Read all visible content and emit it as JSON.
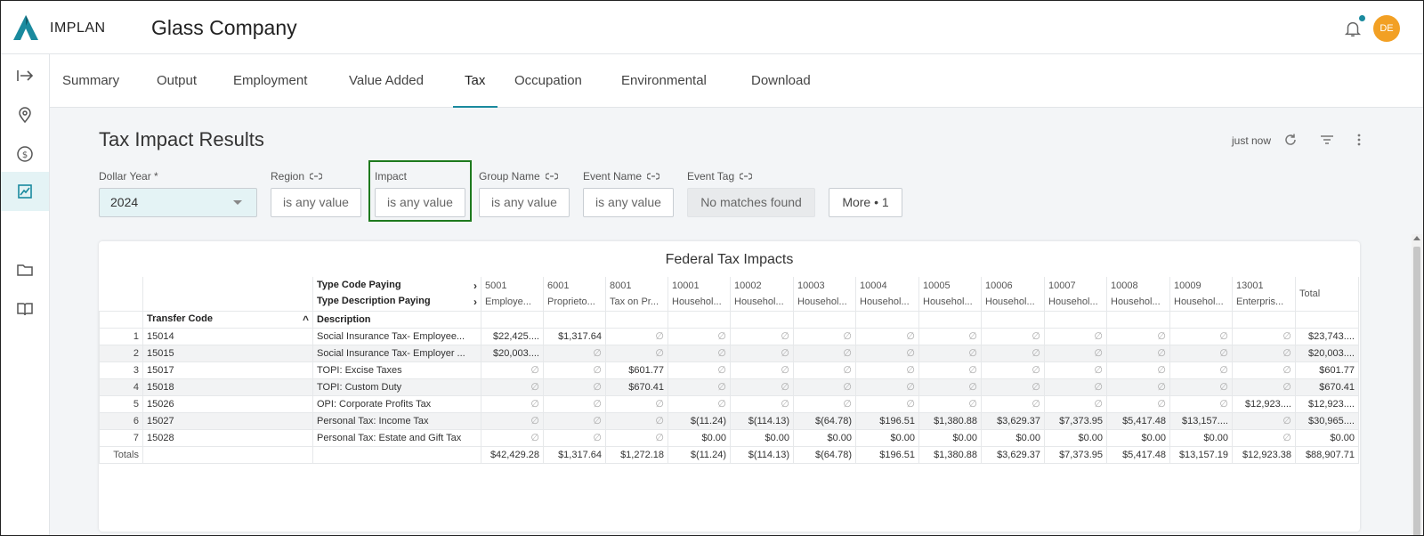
{
  "app": {
    "logo_text": "IMPLAN",
    "title": "Glass Company",
    "avatar_initials": "DE"
  },
  "tabs": [
    {
      "label": "Summary"
    },
    {
      "label": "Output"
    },
    {
      "label": "Employment"
    },
    {
      "label": "Value Added"
    },
    {
      "label": "Tax"
    },
    {
      "label": "Occupation"
    },
    {
      "label": "Environmental"
    },
    {
      "label": "Download"
    }
  ],
  "active_tab": "Tax",
  "page": {
    "title": "Tax Impact Results",
    "updated": "just now"
  },
  "filters": {
    "dollar_year": {
      "label": "Dollar Year *",
      "value": "2024"
    },
    "region": {
      "label": "Region",
      "value": "is any value"
    },
    "impact": {
      "label": "Impact",
      "value": "is any value"
    },
    "group_name": {
      "label": "Group Name",
      "value": "is any value"
    },
    "event_name": {
      "label": "Event Name",
      "value": "is any value"
    },
    "event_tag": {
      "label": "Event Tag",
      "value": "No matches found"
    },
    "more": {
      "label": "More • 1"
    }
  },
  "table": {
    "title": "Federal Tax Impacts",
    "header_type_code": "Type Code Paying",
    "header_type_desc": "Type Description Paying",
    "header_transfer_code": "Transfer Code",
    "header_description": "Description",
    "columns": [
      {
        "code": "5001",
        "desc": "Employe..."
      },
      {
        "code": "6001",
        "desc": "Proprieto..."
      },
      {
        "code": "8001",
        "desc": "Tax on Pr..."
      },
      {
        "code": "10001",
        "desc": "Househol..."
      },
      {
        "code": "10002",
        "desc": "Househol..."
      },
      {
        "code": "10003",
        "desc": "Househol..."
      },
      {
        "code": "10004",
        "desc": "Househol..."
      },
      {
        "code": "10005",
        "desc": "Househol..."
      },
      {
        "code": "10006",
        "desc": "Househol..."
      },
      {
        "code": "10007",
        "desc": "Househol..."
      },
      {
        "code": "10008",
        "desc": "Househol..."
      },
      {
        "code": "10009",
        "desc": "Househol..."
      },
      {
        "code": "13001",
        "desc": "Enterpris..."
      }
    ],
    "total_header": "Total",
    "null_symbol": "∅",
    "rows": [
      {
        "n": "1",
        "code": "15014",
        "desc": "Social Insurance Tax- Employee...",
        "values": [
          "$22,425....",
          "$1,317.64",
          null,
          null,
          null,
          null,
          null,
          null,
          null,
          null,
          null,
          null,
          null
        ],
        "total": "$23,743...."
      },
      {
        "n": "2",
        "code": "15015",
        "desc": "Social Insurance Tax- Employer ...",
        "values": [
          "$20,003....",
          null,
          null,
          null,
          null,
          null,
          null,
          null,
          null,
          null,
          null,
          null,
          null
        ],
        "total": "$20,003...."
      },
      {
        "n": "3",
        "code": "15017",
        "desc": "TOPI: Excise Taxes",
        "values": [
          null,
          null,
          "$601.77",
          null,
          null,
          null,
          null,
          null,
          null,
          null,
          null,
          null,
          null
        ],
        "total": "$601.77"
      },
      {
        "n": "4",
        "code": "15018",
        "desc": "TOPI: Custom Duty",
        "values": [
          null,
          null,
          "$670.41",
          null,
          null,
          null,
          null,
          null,
          null,
          null,
          null,
          null,
          null
        ],
        "total": "$670.41"
      },
      {
        "n": "5",
        "code": "15026",
        "desc": "OPI: Corporate Profits Tax",
        "values": [
          null,
          null,
          null,
          null,
          null,
          null,
          null,
          null,
          null,
          null,
          null,
          null,
          "$12,923...."
        ],
        "total": "$12,923...."
      },
      {
        "n": "6",
        "code": "15027",
        "desc": "Personal Tax: Income Tax",
        "values": [
          null,
          null,
          null,
          "$(11.24)",
          "$(114.13)",
          "$(64.78)",
          "$196.51",
          "$1,380.88",
          "$3,629.37",
          "$7,373.95",
          "$5,417.48",
          "$13,157....",
          null
        ],
        "total": "$30,965...."
      },
      {
        "n": "7",
        "code": "15028",
        "desc": "Personal Tax: Estate and Gift Tax",
        "values": [
          null,
          null,
          null,
          "$0.00",
          "$0.00",
          "$0.00",
          "$0.00",
          "$0.00",
          "$0.00",
          "$0.00",
          "$0.00",
          "$0.00",
          null
        ],
        "total": "$0.00"
      }
    ],
    "totals_label": "Totals",
    "totals": [
      "$42,429.28",
      "$1,317.64",
      "$1,272.18",
      "$(11.24)",
      "$(114.13)",
      "$(64.78)",
      "$196.51",
      "$1,380.88",
      "$3,629.37",
      "$7,373.95",
      "$5,417.48",
      "$13,157.19",
      "$12,923.38"
    ],
    "grand_total": "$88,907.71"
  }
}
